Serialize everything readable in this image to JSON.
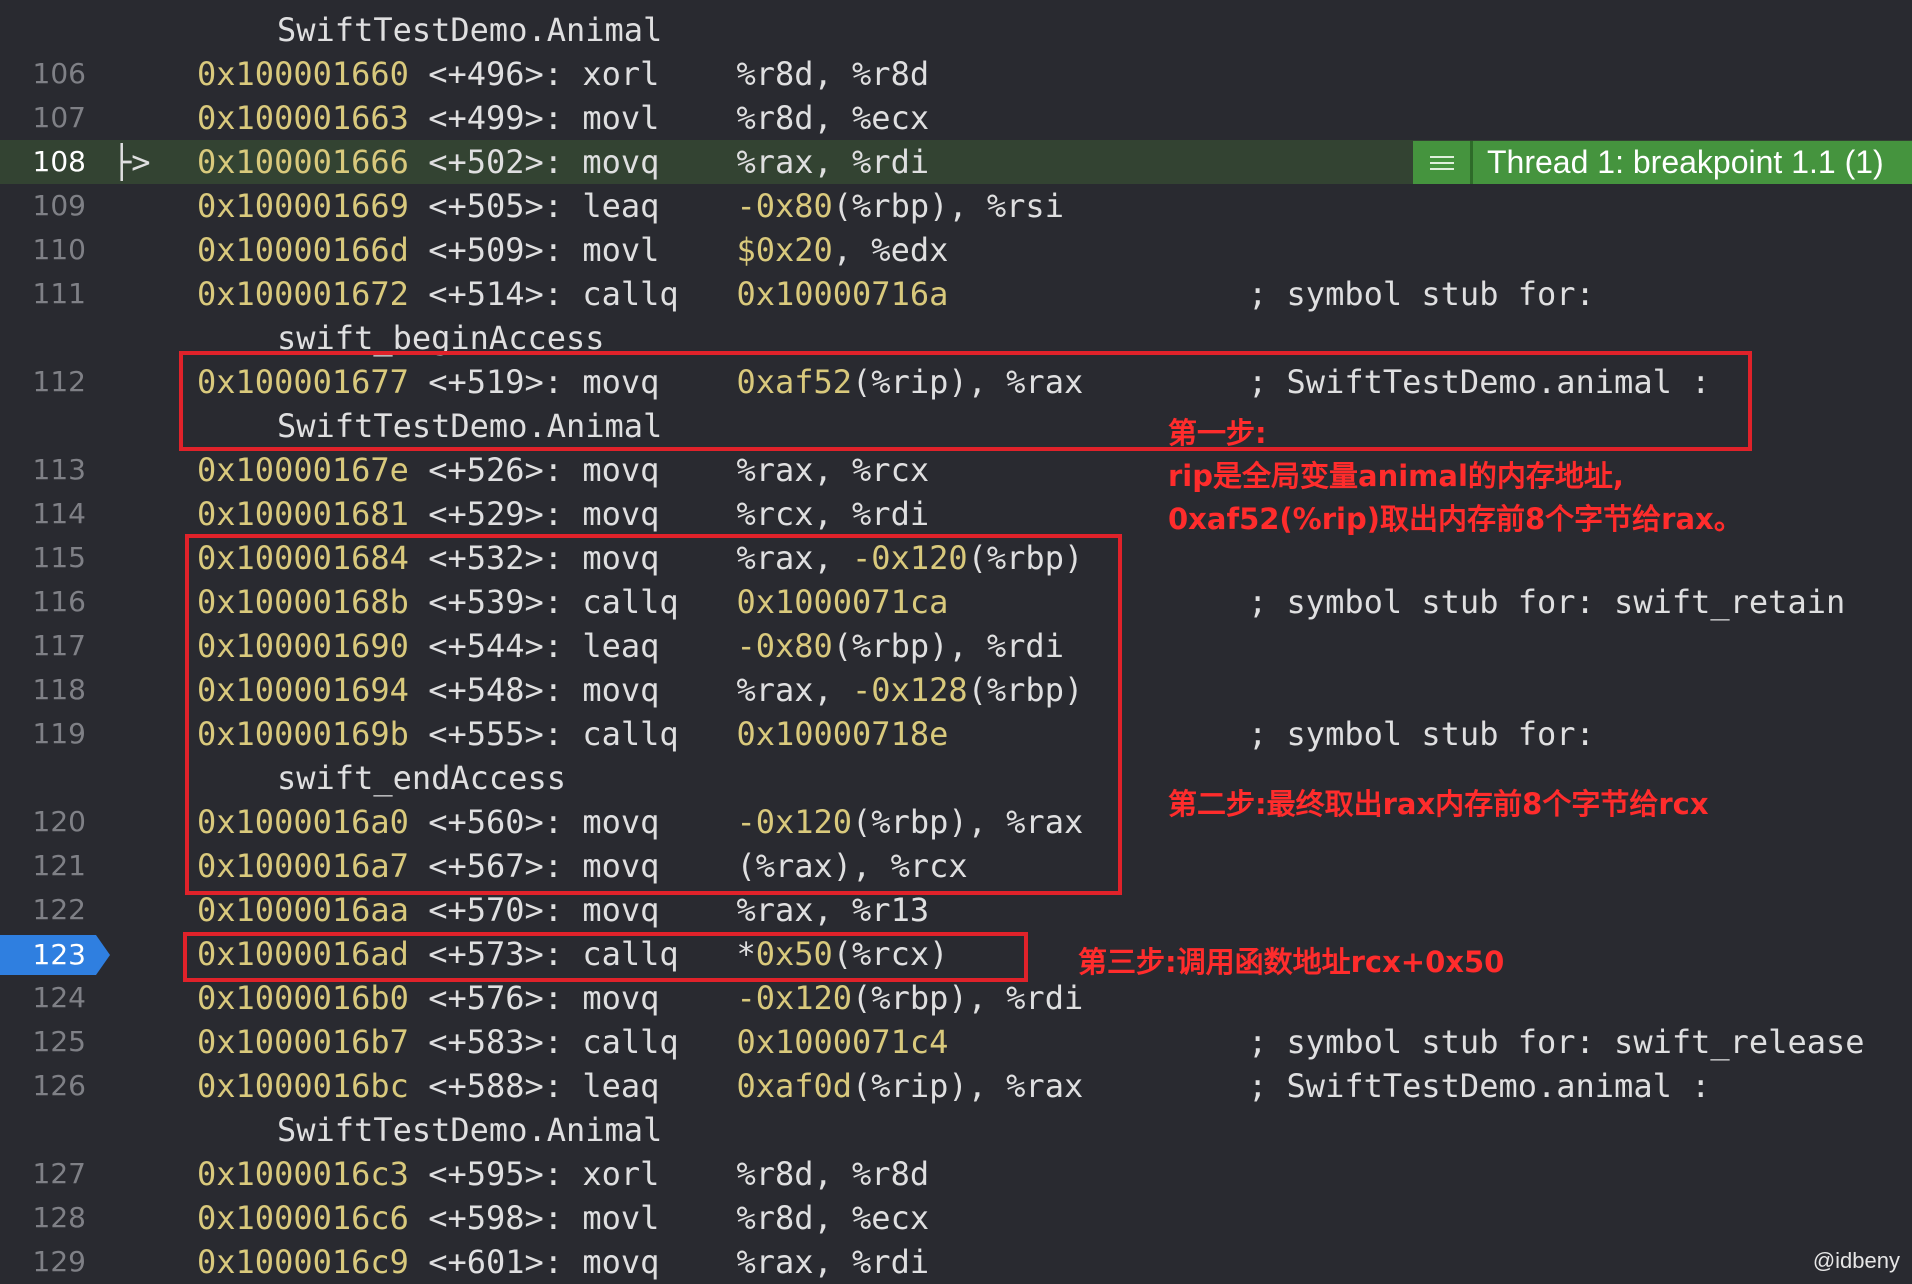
{
  "editor": {
    "lines": [
      {
        "num": "",
        "cont": "SwiftTestDemo.Animal"
      },
      {
        "num": "106",
        "addr": "0x100001660",
        "off": "<+496>:",
        "mn": "xorl",
        "pre": "%r8d, %r8d",
        "numv": "",
        "post": "",
        "comment": ""
      },
      {
        "num": "107",
        "addr": "0x100001663",
        "off": "<+499>:",
        "mn": "movl",
        "pre": "%r8d, %ecx",
        "numv": "",
        "post": "",
        "comment": ""
      },
      {
        "num": "108",
        "addr": "0x100001666",
        "off": "<+502>:",
        "mn": "movq",
        "pre": "%rax, %rdi",
        "numv": "",
        "post": "",
        "comment": ""
      },
      {
        "num": "109",
        "addr": "0x100001669",
        "off": "<+505>:",
        "mn": "leaq",
        "pre": "",
        "numv": "-0x80",
        "post": "(%rbp), %rsi",
        "comment": ""
      },
      {
        "num": "110",
        "addr": "0x10000166d",
        "off": "<+509>:",
        "mn": "movl",
        "pre": "",
        "numv": "$0x20",
        "post": ", %edx",
        "comment": ""
      },
      {
        "num": "111",
        "addr": "0x100001672",
        "off": "<+514>:",
        "mn": "callq",
        "pre": "",
        "numv": "0x10000716a",
        "post": "",
        "comment": "; symbol stub for:"
      },
      {
        "num": "",
        "cont": "swift_beginAccess"
      },
      {
        "num": "112",
        "addr": "0x100001677",
        "off": "<+519>:",
        "mn": "movq",
        "pre": "",
        "numv": "0xaf52",
        "post": "(%rip), %rax",
        "comment": "; SwiftTestDemo.animal :"
      },
      {
        "num": "",
        "cont": "SwiftTestDemo.Animal"
      },
      {
        "num": "113",
        "addr": "0x10000167e",
        "off": "<+526>:",
        "mn": "movq",
        "pre": "%rax, %rcx",
        "numv": "",
        "post": "",
        "comment": ""
      },
      {
        "num": "114",
        "addr": "0x100001681",
        "off": "<+529>:",
        "mn": "movq",
        "pre": "%rcx, %rdi",
        "numv": "",
        "post": "",
        "comment": ""
      },
      {
        "num": "115",
        "addr": "0x100001684",
        "off": "<+532>:",
        "mn": "movq",
        "pre": "%rax, ",
        "numv": "-0x120",
        "post": "(%rbp)",
        "comment": ""
      },
      {
        "num": "116",
        "addr": "0x10000168b",
        "off": "<+539>:",
        "mn": "callq",
        "pre": "",
        "numv": "0x1000071ca",
        "post": "",
        "comment": "; symbol stub for: swift_retain"
      },
      {
        "num": "117",
        "addr": "0x100001690",
        "off": "<+544>:",
        "mn": "leaq",
        "pre": "",
        "numv": "-0x80",
        "post": "(%rbp), %rdi",
        "comment": ""
      },
      {
        "num": "118",
        "addr": "0x100001694",
        "off": "<+548>:",
        "mn": "movq",
        "pre": "%rax, ",
        "numv": "-0x128",
        "post": "(%rbp)",
        "comment": ""
      },
      {
        "num": "119",
        "addr": "0x10000169b",
        "off": "<+555>:",
        "mn": "callq",
        "pre": "",
        "numv": "0x10000718e",
        "post": "",
        "comment": "; symbol stub for:"
      },
      {
        "num": "",
        "cont": "swift_endAccess"
      },
      {
        "num": "120",
        "addr": "0x1000016a0",
        "off": "<+560>:",
        "mn": "movq",
        "pre": "",
        "numv": "-0x120",
        "post": "(%rbp), %rax",
        "comment": ""
      },
      {
        "num": "121",
        "addr": "0x1000016a7",
        "off": "<+567>:",
        "mn": "movq",
        "pre": "(%rax), %rcx",
        "numv": "",
        "post": "",
        "comment": ""
      },
      {
        "num": "122",
        "addr": "0x1000016aa",
        "off": "<+570>:",
        "mn": "movq",
        "pre": "%rax, %r13",
        "numv": "",
        "post": "",
        "comment": ""
      },
      {
        "num": "123",
        "addr": "0x1000016ad",
        "off": "<+573>:",
        "mn": "callq",
        "pre": "*",
        "numv": "0x50",
        "post": "(%rcx)",
        "comment": ""
      },
      {
        "num": "124",
        "addr": "0x1000016b0",
        "off": "<+576>:",
        "mn": "movq",
        "pre": "",
        "numv": "-0x120",
        "post": "(%rbp), %rdi",
        "comment": ""
      },
      {
        "num": "125",
        "addr": "0x1000016b7",
        "off": "<+583>:",
        "mn": "callq",
        "pre": "",
        "numv": "0x1000071c4",
        "post": "",
        "comment": "; symbol stub for: swift_release"
      },
      {
        "num": "126",
        "addr": "0x1000016bc",
        "off": "<+588>:",
        "mn": "leaq",
        "pre": "",
        "numv": "0xaf0d",
        "post": "(%rip), %rax",
        "comment": "; SwiftTestDemo.animal :"
      },
      {
        "num": "",
        "cont": "SwiftTestDemo.Animal"
      },
      {
        "num": "127",
        "addr": "0x1000016c3",
        "off": "<+595>:",
        "mn": "xorl",
        "pre": "%r8d, %r8d",
        "numv": "",
        "post": "",
        "comment": ""
      },
      {
        "num": "128",
        "addr": "0x1000016c6",
        "off": "<+598>:",
        "mn": "movl",
        "pre": "%r8d, %ecx",
        "numv": "",
        "post": "",
        "comment": ""
      },
      {
        "num": "129",
        "addr": "0x1000016c9",
        "off": "<+601>:",
        "mn": "movq",
        "pre": "%rax, %rdi",
        "numv": "",
        "post": "",
        "comment": ""
      }
    ],
    "current_line": "108",
    "current_line_marker": "├>",
    "breakpoint_line": "123"
  },
  "thread_badge": {
    "label": "Thread 1: breakpoint 1.1 (1)",
    "color": "#45943e",
    "icon": "list-menu-icon"
  },
  "annotations": {
    "step1_title": "第一步:",
    "step1_line1": "rip是全局变量animal的内存地址,",
    "step1_line2": "0xaf52(%rip)取出内存前8个字节给rax。",
    "step2": "第二步:最终取出rax内存前8个字节给rcx",
    "step3": "第三步:调用函数地址rcx+0x50",
    "color": "#e0222a"
  },
  "watermark": "@idbeny",
  "colors": {
    "background": "#292a30",
    "address": "#d9c97c",
    "breakpoint": "#2f7fe0",
    "current_line": "#334332"
  }
}
